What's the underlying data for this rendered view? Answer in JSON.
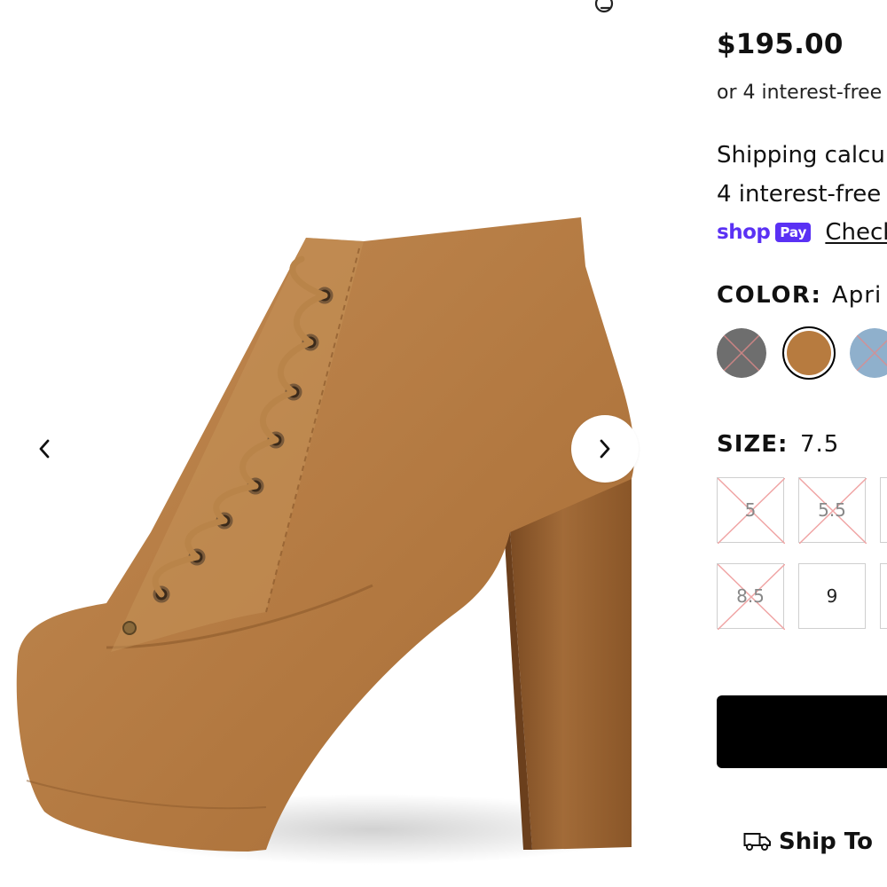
{
  "product": {
    "price": "$195.00",
    "installments_text": "or 4 interest-free",
    "shipping_text": "Shipping calcu",
    "interest_text": "4 interest-free",
    "shop_pay": {
      "shop": "shop",
      "pay": "Pay",
      "link": "Check"
    }
  },
  "color": {
    "label": "COLOR:",
    "value": "Apri",
    "swatches": [
      {
        "name": "grey",
        "color": "#6e6e6e",
        "available": false
      },
      {
        "name": "tan",
        "color": "#b77b3f",
        "available": true,
        "selected": true
      },
      {
        "name": "light-blue",
        "color": "#8fb0cc",
        "available": false
      }
    ]
  },
  "size": {
    "label": "SIZE:",
    "value": "7.5",
    "options": [
      {
        "label": "5",
        "available": false
      },
      {
        "label": "5.5",
        "available": false
      },
      {
        "label": "8.5",
        "available": false
      },
      {
        "label": "9",
        "available": true
      }
    ]
  },
  "actions": {
    "ship_to": "Ship To"
  },
  "gallery": {
    "prev_icon": "chevron-left-icon",
    "next_icon": "chevron-right-icon",
    "zoom_icon": "magnifier-icon"
  },
  "colors": {
    "accent_shop": "#5a31f4",
    "cart_button": "#000000",
    "suede": "#b77b3f",
    "heel_wood": "#9a6431"
  }
}
